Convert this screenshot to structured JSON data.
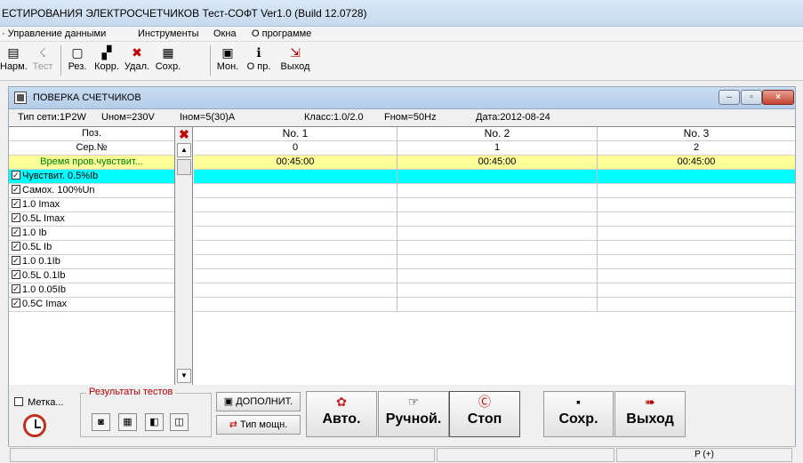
{
  "app": {
    "title": "ЕСТИРОВАНИЯ ЭЛЕКТРОСЧЕТЧИКОВ Тест-СОФТ   Ver1.0 (Build 12.0728)"
  },
  "menu": [
    {
      "label": "· Управление данными"
    },
    {
      "label": "Инструменты"
    },
    {
      "label": "Окна"
    },
    {
      "label": "О программе"
    }
  ],
  "toolbar": [
    {
      "label": "Нарм.",
      "icon": "▤"
    },
    {
      "label": "Тест",
      "icon": "☇"
    },
    {
      "label": "Рез.",
      "icon": "▢"
    },
    {
      "label": "Корр.",
      "icon": "▞"
    },
    {
      "label": "Удал.",
      "icon": "✖"
    },
    {
      "label": "Сохр.",
      "icon": "▦"
    },
    {
      "label": "Мон.",
      "icon": "▣"
    },
    {
      "label": "О пр.",
      "icon": "ℹ"
    },
    {
      "label": "Выход",
      "icon": "⇲"
    }
  ],
  "child": {
    "title": "ПОВЕРКА СЧЕТЧИКОВ",
    "minimize": "–",
    "restore": "▫",
    "close": "×"
  },
  "info": {
    "net": "Тип сети:1P2W",
    "unom": "Uном=230V",
    "inom": "Iном=5(30)A",
    "class": "Класс:1.0/2.0",
    "fnom": "Fном=50Hz",
    "date": "Дата:2012-08-24"
  },
  "grid": {
    "pos_header": "Поз.",
    "ser_header": "Сер.№",
    "time_label": "Время пров.чувствит...",
    "columns": [
      {
        "name": "No. 1",
        "serial": "0",
        "time": "00:45:00"
      },
      {
        "name": "No. 2",
        "serial": "1",
        "time": "00:45:00"
      },
      {
        "name": "No. 3",
        "serial": "2",
        "time": "00:45:00"
      }
    ],
    "tests": [
      {
        "label": "Чувствит. 0.5%Ib",
        "checked": true
      },
      {
        "label": "Самох. 100%Un",
        "checked": true
      },
      {
        "label": "1.0 Imax",
        "checked": true
      },
      {
        "label": "0.5L Imax",
        "checked": true
      },
      {
        "label": "1.0 Ib",
        "checked": true
      },
      {
        "label": "0.5L Ib",
        "checked": true
      },
      {
        "label": "1.0 0.1Ib",
        "checked": true
      },
      {
        "label": "0.5L 0.1Ib",
        "checked": true
      },
      {
        "label": "1.0 0.05Ib",
        "checked": true
      },
      {
        "label": "0.5C Imax",
        "checked": true
      }
    ],
    "scroll_up": "▲",
    "scroll_down": "▼",
    "delete_icon": "✖"
  },
  "bottom": {
    "metka": "Метка...",
    "results_title": "Результаты тестов",
    "results_icons": [
      "◙",
      "▦",
      "◧",
      "◫"
    ],
    "dopolnit": "ДОПОЛНИТ.",
    "tip_moshn": "Тип мощн.",
    "auto": "Авто.",
    "manual": "Ручной.",
    "stop": "Стоп",
    "save": "Сохр.",
    "exit": "Выход",
    "auto_icon": "✿",
    "manual_icon": "☞",
    "stop_icon": "Ⓒ",
    "save_icon": "▪",
    "exit_icon": "➠",
    "dop_icon": "▣",
    "tip_icon": "⇄"
  },
  "status": {
    "panel3": "P (+)"
  },
  "colors": {
    "time_row": "#ffff99",
    "selected_row": "#00ffff",
    "time_text": "#008000"
  }
}
